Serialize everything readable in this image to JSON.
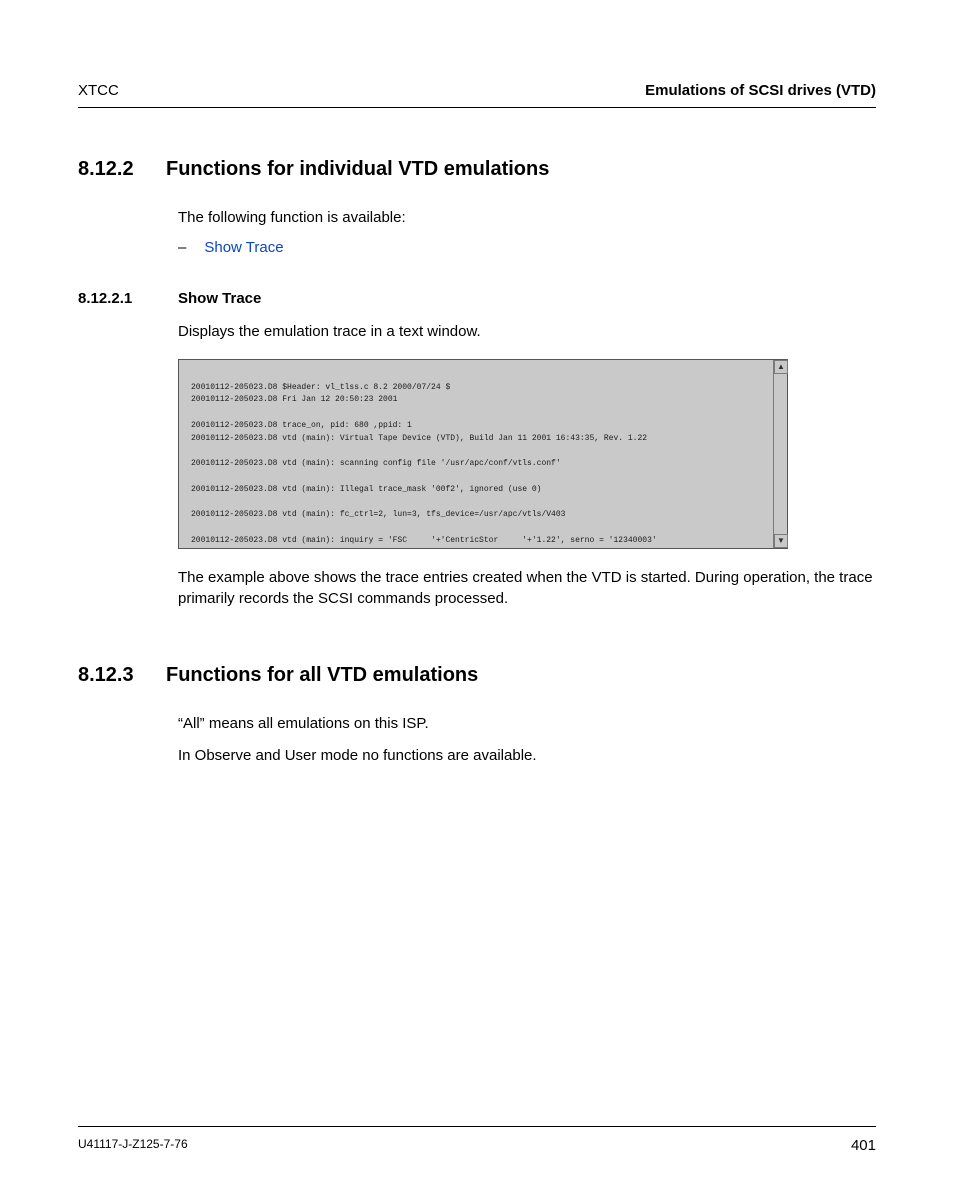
{
  "header": {
    "left": "XTCC",
    "right": "Emulations of SCSI drives (VTD)"
  },
  "sec_8_12_2": {
    "num": "8.12.2",
    "title": "Functions for individual VTD emulations",
    "intro": "The following function is available:",
    "bullet_dash": "–",
    "link_show_trace": "Show Trace"
  },
  "sec_8_12_2_1": {
    "num": "8.12.2.1",
    "title": "Show Trace",
    "desc": "Displays the emulation trace in a text window.",
    "trace_lines": "20010112-205023.D8 $Header: vl_tlss.c 8.2 2000/07/24 $\n20010112-205023.D8 Fri Jan 12 20:50:23 2001\n\n20010112-205023.D8 trace_on, pid: 680 ,ppid: 1\n20010112-205023.D8 vtd (main): Virtual Tape Device (VTD), Build Jan 11 2001 16:43:35, Rev. 1.22\n\n20010112-205023.D8 vtd (main): scanning config file '/usr/apc/conf/vtls.conf'\n\n20010112-205023.D8 vtd (main): Illegal trace_mask '00f2', ignored (use 0)\n\n20010112-205023.D8 vtd (main): fc_ctrl=2, lun=3, tfs_device=/usr/apc/vtls/V403\n\n20010112-205023.D8 vtd (main): inquiry = 'FSC     '+'CentricStor     '+'1.22', serno = '12340003'",
    "caption": "The example above shows the trace entries created when the VTD is started. During operation, the trace primarily records the SCSI commands processed."
  },
  "sec_8_12_3": {
    "num": "8.12.3",
    "title": "Functions for all VTD emulations",
    "p1": "“All” means all emulations on this ISP.",
    "p2": "In Observe and User mode no functions are available."
  },
  "footer": {
    "docid": "U41117-J-Z125-7-76",
    "page": "401"
  },
  "icons": {
    "arrow_up": "▲",
    "arrow_down": "▼"
  }
}
